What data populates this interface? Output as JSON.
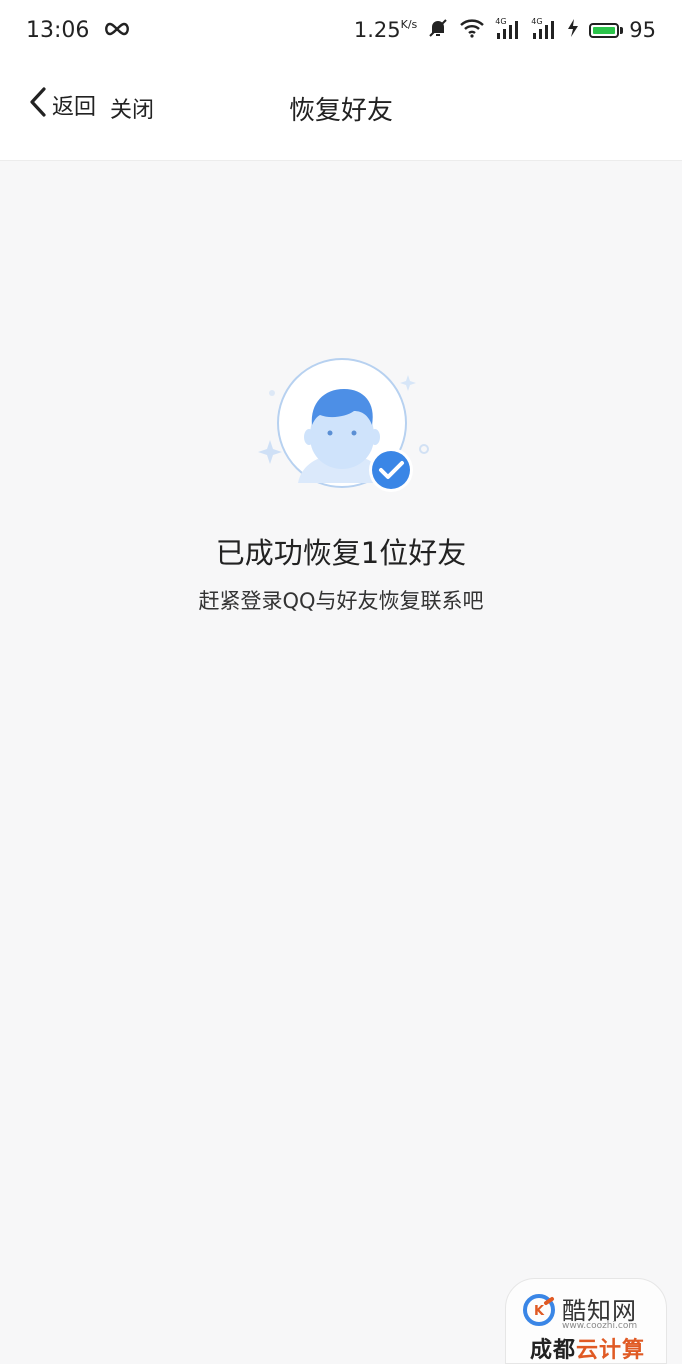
{
  "status_bar": {
    "time": "13:06",
    "net_speed": "1.25",
    "net_speed_unit": "K/s",
    "sim1": "4G",
    "sim2": "4G",
    "battery": "95",
    "battery_color": "#2bc44a"
  },
  "nav": {
    "back_label": "返回",
    "close_label": "关闭",
    "title": "恢复好友"
  },
  "main": {
    "headline": "已成功恢复1位好友",
    "subline": "赶紧登录QQ与好友恢复联系吧"
  },
  "watermark": {
    "name": "酷知网",
    "site": "www.coozhi.com",
    "bottom_text_a": "成都",
    "bottom_text_b": "云计算"
  },
  "colors": {
    "accent": "#3a86e6",
    "avatar_fill": "#cfe3fb",
    "hair": "#4d8fe6"
  }
}
